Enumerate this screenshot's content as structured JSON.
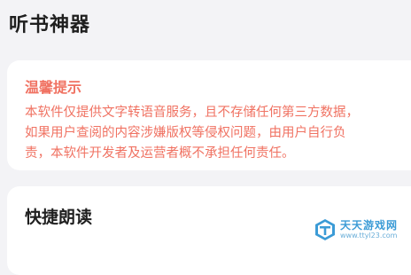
{
  "app": {
    "title": "听书神器"
  },
  "notice": {
    "title": "温馨提示",
    "lines": [
      "本软件仅提供文字转语音服务，且不存储任何第三方数据，",
      "如果用户查阅的内容涉嫌版权等侵权问题，由用户自行负",
      "责，本软件开发者及运营者概不承担任何责任。"
    ],
    "color": "#f07262"
  },
  "quick_read": {
    "title": "快捷朗读"
  },
  "watermark": {
    "name": "天天游戏网",
    "url": "www.ttyl23.com",
    "icon": "tt-logo-icon",
    "color": "#3b9bd6"
  }
}
